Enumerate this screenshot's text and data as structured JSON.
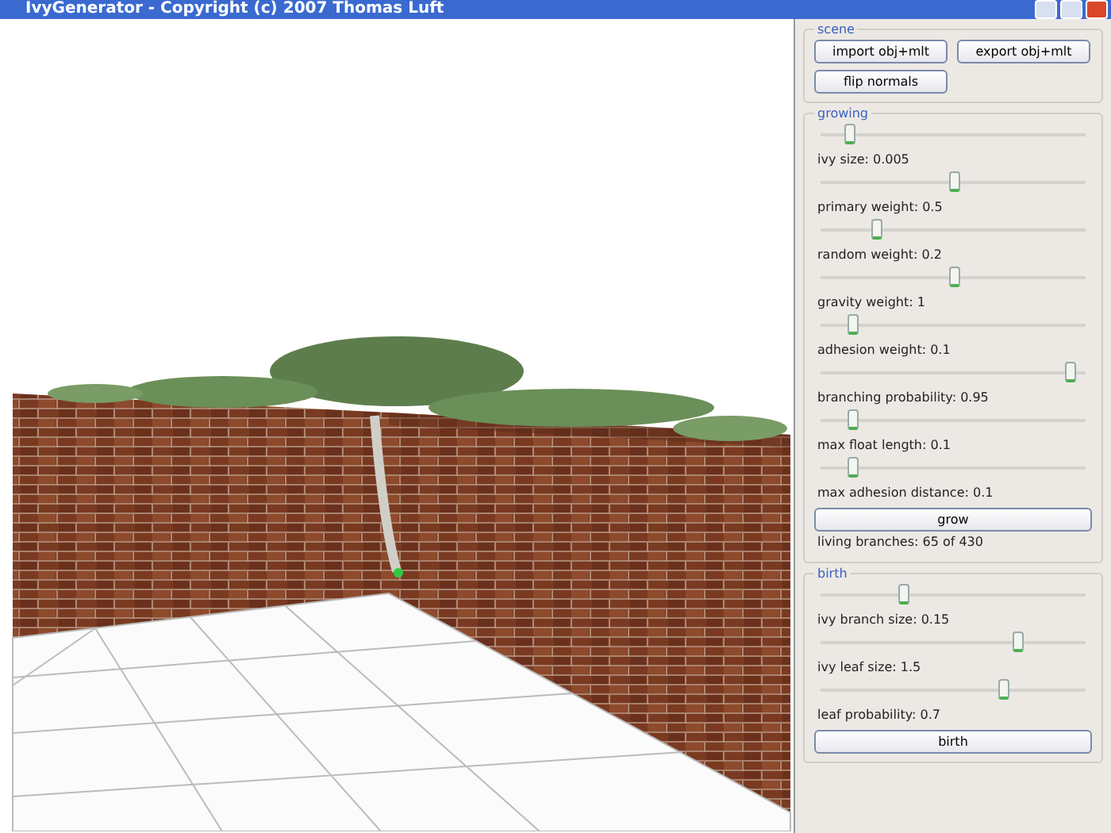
{
  "window": {
    "title": "IvyGenerator - Copyright (c) 2007 Thomas Luft"
  },
  "scene": {
    "title": "scene",
    "buttons": [
      "import obj+mlt",
      "export obj+mlt",
      "flip normals"
    ]
  },
  "growing": {
    "title": "growing",
    "sliders": [
      {
        "label": "ivy size: 0.005",
        "level": 0.11
      },
      {
        "label": "primary weight: 0.5",
        "level": 0.5
      },
      {
        "label": "random weight: 0.2",
        "level": 0.21
      },
      {
        "label": "gravity weight: 1",
        "level": 0.5
      },
      {
        "label": "adhesion weight: 0.1",
        "level": 0.12
      },
      {
        "label": "branching probability: 0.95",
        "level": 0.94
      },
      {
        "label": "max float length: 0.1",
        "level": 0.12
      },
      {
        "label": "max adhesion distance: 0.1",
        "level": 0.12
      }
    ],
    "button": "grow",
    "status": "living branches: 65 of 430"
  },
  "birth": {
    "title": "birth",
    "sliders": [
      {
        "label": "ivy branch size: 0.15",
        "level": 0.31
      },
      {
        "label": "ivy leaf size: 1.5",
        "level": 0.74
      },
      {
        "label": "leaf probability: 0.7",
        "level": 0.69
      }
    ],
    "button": "birth"
  }
}
